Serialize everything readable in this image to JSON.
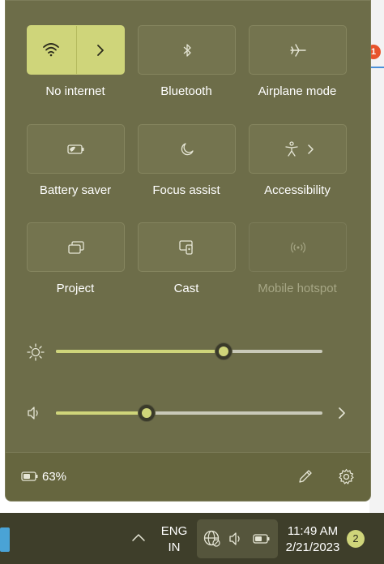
{
  "quick_settings": {
    "tiles": [
      {
        "label": "No internet",
        "icon": "wifi-icon",
        "active": true,
        "disabled": false
      },
      {
        "label": "Bluetooth",
        "icon": "bluetooth-icon",
        "active": false,
        "disabled": false
      },
      {
        "label": "Airplane mode",
        "icon": "airplane-icon",
        "active": false,
        "disabled": false
      },
      {
        "label": "Battery saver",
        "icon": "battery-saver-icon",
        "active": false,
        "disabled": false
      },
      {
        "label": "Focus assist",
        "icon": "moon-icon",
        "active": false,
        "disabled": false
      },
      {
        "label": "Accessibility",
        "icon": "accessibility-icon",
        "active": false,
        "disabled": false
      },
      {
        "label": "Project",
        "icon": "project-icon",
        "active": false,
        "disabled": false
      },
      {
        "label": "Cast",
        "icon": "cast-icon",
        "active": false,
        "disabled": false
      },
      {
        "label": "Mobile hotspot",
        "icon": "hotspot-icon",
        "active": false,
        "disabled": true
      }
    ],
    "brightness": {
      "icon": "sun-icon",
      "value_percent": 63
    },
    "volume": {
      "icon": "speaker-icon",
      "value_percent": 34
    },
    "battery": {
      "icon": "battery-icon",
      "percent_label": "63%"
    },
    "footer_icons": [
      "edit-pencil-icon",
      "settings-gear-icon"
    ]
  },
  "taskbar": {
    "language_line1": "ENG",
    "language_line2": "IN",
    "time": "11:49 AM",
    "date": "2/21/2023",
    "notification_count": "2",
    "tray_icons": [
      "chevron-up-icon",
      "globe-icon",
      "volume-icon",
      "battery-icon"
    ]
  },
  "background_app": {
    "badge_count": "1"
  },
  "colors": {
    "accent": "#cfd57a",
    "panel": "#6d6d49",
    "taskbar": "#3e3e2a"
  }
}
